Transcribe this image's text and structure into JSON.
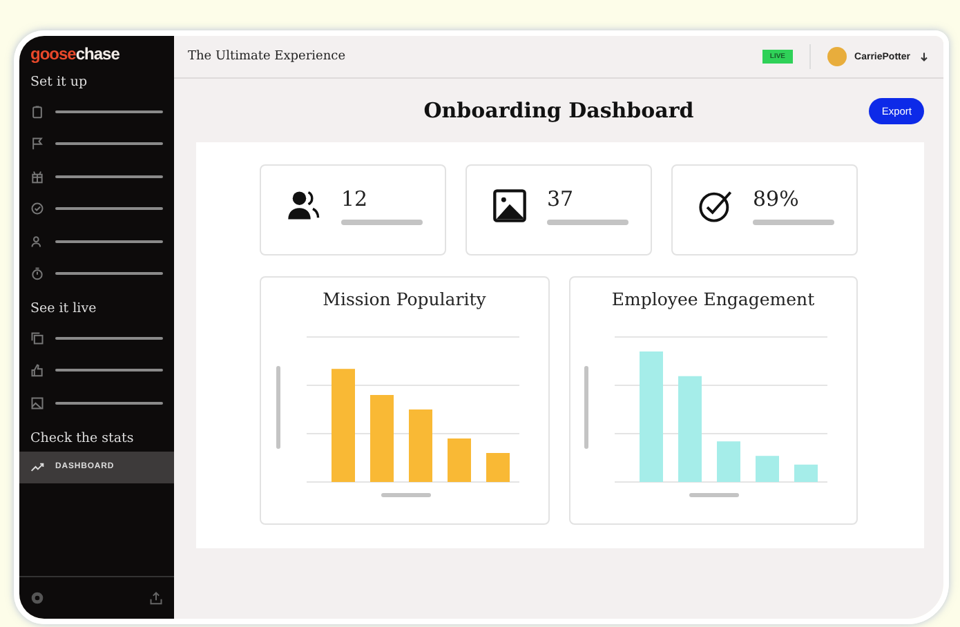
{
  "brand": {
    "part_1": "goose",
    "part_2": "chase"
  },
  "sidebar": {
    "sections": [
      {
        "heading": "Set it up",
        "items": [
          {
            "kind": "clipboard",
            "selected": false
          },
          {
            "kind": "flag",
            "selected": false
          },
          {
            "kind": "gift",
            "selected": false
          },
          {
            "kind": "badge",
            "selected": false
          },
          {
            "kind": "people",
            "selected": false
          },
          {
            "kind": "timer",
            "selected": false
          }
        ]
      },
      {
        "heading": "See it live",
        "items": [
          {
            "kind": "copy",
            "selected": false
          },
          {
            "kind": "thumb",
            "selected": false
          },
          {
            "kind": "image",
            "selected": false
          }
        ]
      },
      {
        "heading": "Check the stats",
        "items": [
          {
            "kind": "trend",
            "label": "DASHBOARD",
            "selected": true
          }
        ]
      }
    ]
  },
  "header": {
    "title": "The Ultimate Experience",
    "badge": "LIVE",
    "user": "CarriePotter"
  },
  "page": {
    "title": "Onboarding Dashboard",
    "export": "Export"
  },
  "stats": [
    {
      "kind": "people",
      "value": "12"
    },
    {
      "kind": "image",
      "value": "37"
    },
    {
      "kind": "check",
      "value": "89%"
    }
  ],
  "charts": [
    {
      "title": "Mission Popularity",
      "color": "#f9b935"
    },
    {
      "title": "Employee Engagement",
      "color": "#a5ede9"
    }
  ]
}
